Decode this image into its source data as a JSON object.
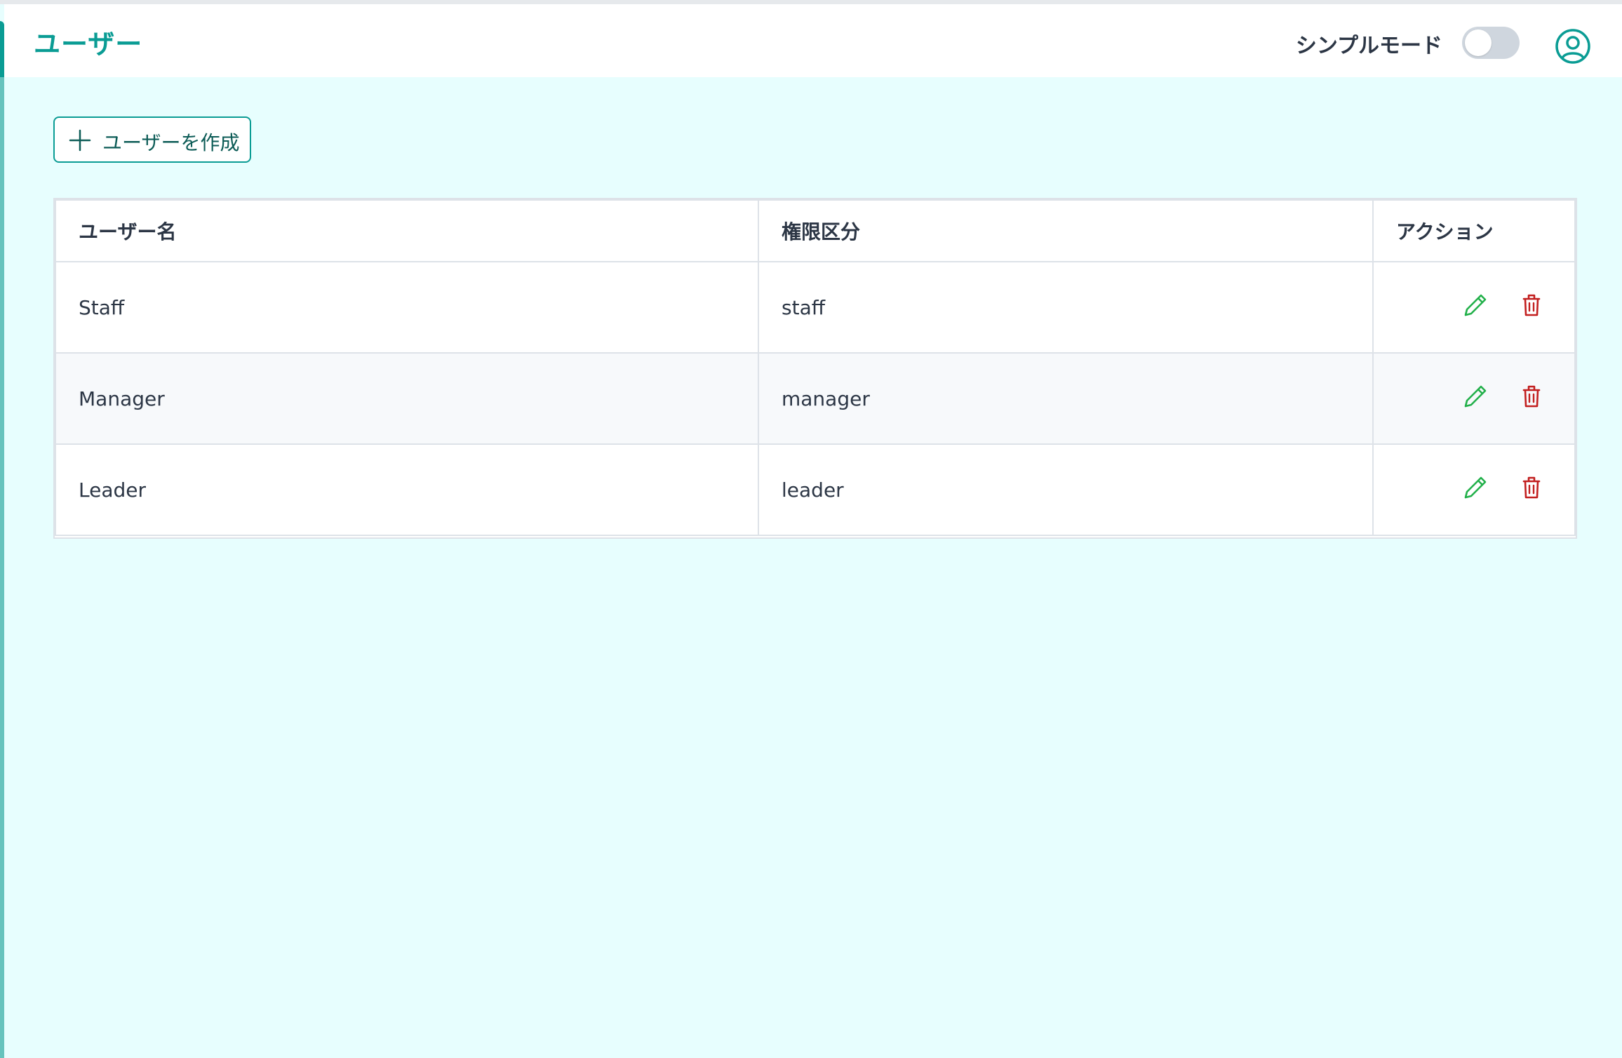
{
  "header": {
    "title": "ユーザー",
    "simple_mode_label": "シンプルモード",
    "simple_mode_on": false
  },
  "toolbar": {
    "create_user_label": "ユーザーを作成"
  },
  "table": {
    "columns": [
      "ユーザー名",
      "権限区分",
      "アクション"
    ],
    "rows": [
      {
        "name": "Staff",
        "role": "staff"
      },
      {
        "name": "Manager",
        "role": "manager"
      },
      {
        "name": "Leader",
        "role": "leader"
      }
    ]
  },
  "colors": {
    "accent": "#0a9c94",
    "background": "#e7fefe",
    "edit": "#22b04a",
    "delete": "#c21f1f"
  },
  "icons": {
    "user": "user-circle-icon",
    "create": "plus-icon",
    "edit": "pencil-icon",
    "delete": "trash-icon"
  }
}
